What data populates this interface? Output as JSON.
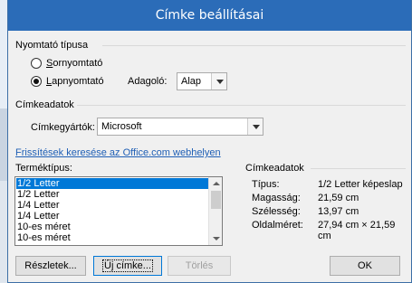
{
  "window": {
    "title": "Címke beállításai"
  },
  "printer_type": {
    "group_label": "Nyomtató típusa",
    "options": [
      {
        "label": "Sornyomtató",
        "checked": false
      },
      {
        "label": "Lapnyomtató",
        "checked": true
      }
    ],
    "feeder_label": "Adagoló:",
    "feeder_value": "Alap"
  },
  "label_data": {
    "group_label": "Címkeadatok",
    "vendor_label": "Címkegyártók:",
    "vendor_value": "Microsoft",
    "update_link": "Frissítések keresése az Office.com webhelyen"
  },
  "product_type": {
    "label": "Terméktípus:",
    "items": [
      "1/2 Letter",
      "1/2 Letter",
      "1/4 Letter",
      "1/4 Letter",
      "10-es méret",
      "10-es méret"
    ],
    "selected_index": 0
  },
  "info": {
    "group_label": "Címkeadatok",
    "rows": [
      {
        "label": "Típus:",
        "value": "1/2 Letter képeslap"
      },
      {
        "label": "Magasság:",
        "value": "21,59 cm"
      },
      {
        "label": "Szélesség:",
        "value": "13,97 cm"
      },
      {
        "label": "Oldalméret:",
        "value": "27,94 cm × 21,59 cm"
      }
    ]
  },
  "buttons": {
    "details": "Részletek...",
    "new_label": "Új címke...",
    "delete": "Törlés",
    "ok": "OK"
  },
  "colors": {
    "titlebar": "#2b6cb8",
    "accent": "#0078d7",
    "link": "#1f5fb5"
  }
}
